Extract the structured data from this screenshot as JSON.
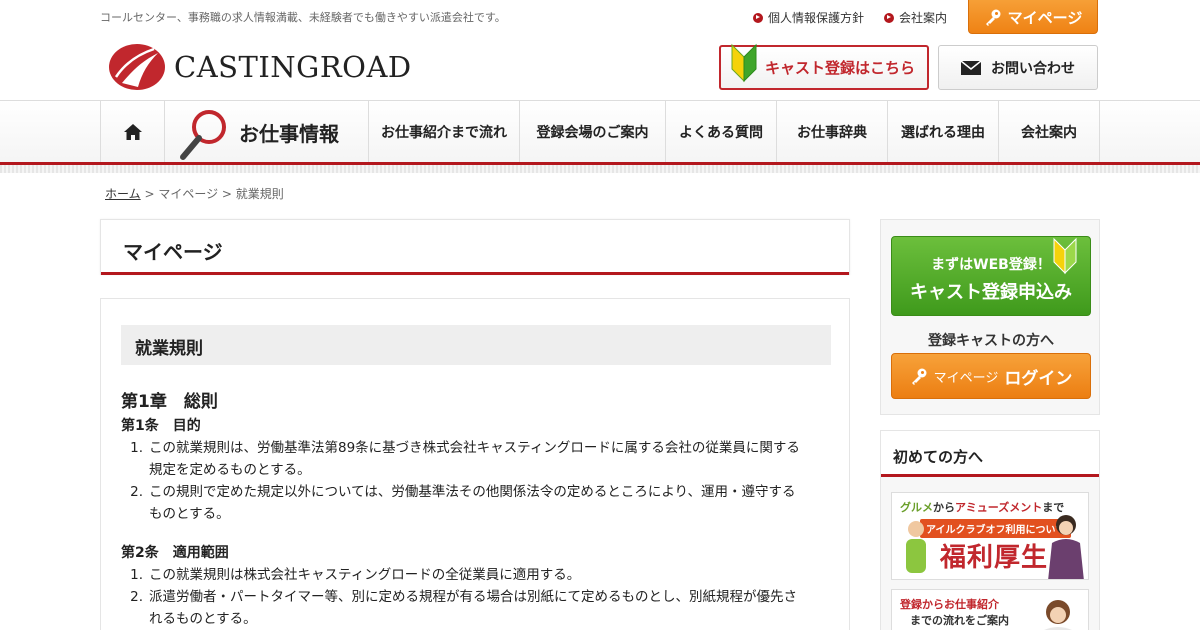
{
  "header": {
    "tagline": "コールセンター、事務職の求人情報満載、未経験者でも働きやすい派遣会社です。",
    "links": [
      "個人情報保護方針",
      "会社案内"
    ],
    "mypage_label": "マイページ",
    "logo_text": "CASTINGROAD",
    "cast_register_label": "キャスト登録はこちら",
    "contact_label": "お問い合わせ"
  },
  "nav": {
    "jobs_label": "お仕事情報",
    "items": [
      "お仕事紹介まで流れ",
      "登録会場のご案内",
      "よくある質問",
      "お仕事辞典",
      "選ばれる理由",
      "会社案内"
    ]
  },
  "breadcrumb": {
    "home": "ホーム",
    "sep": " > ",
    "mypage": "マイページ",
    "current": "就業規則"
  },
  "main": {
    "page_title": "マイページ",
    "section_title": "就業規則",
    "chapter": "第1章　総則",
    "articles": [
      {
        "title": "第1条　目的",
        "items": [
          {
            "num": "1.",
            "line1": "この就業規則は、労働基準法第89条に基づき株式会社キャスティングロードに属する会社の従業員に関する",
            "line2": "規定を定めるものとする。"
          },
          {
            "num": "2.",
            "line1": "この規則で定めた規定以外については、労働基準法その他関係法令の定めるところにより、運用・遵守する",
            "line2": "ものとする。"
          }
        ]
      },
      {
        "title": "第2条　適用範囲",
        "items": [
          {
            "num": "1.",
            "line1": "この就業規則は株式会社キャスティングロードの全従業員に適用する。",
            "line2": ""
          },
          {
            "num": "2.",
            "line1": "派遣労働者・パートタイマー等、別に定める規程が有る場合は別紙にて定めるものとし、別紙規程が優先さ",
            "line2": "れるものとする。"
          }
        ]
      }
    ]
  },
  "sidebar": {
    "web_reg_line1": "まずはWEB登録！",
    "web_reg_line2": "キャスト登録申込み",
    "registered_label": "登録キャストの方へ",
    "login_small": "マイページ",
    "login_big": "ログイン",
    "first_time_heading": "初めての方へ",
    "banner1": {
      "line1_a": "グルメ",
      "line1_b": "から",
      "line1_c": "アミューズメント",
      "line1_d": "まで",
      "pill": "アイルクラブオフ利用について",
      "big": "福利厚生"
    },
    "banner2": {
      "line1": "登録からお仕事紹介",
      "line2": "までの流れをご案内"
    }
  },
  "colors": {
    "brand_red": "#b3171d",
    "orange": "#ef8214",
    "green": "#3f9a1c"
  }
}
